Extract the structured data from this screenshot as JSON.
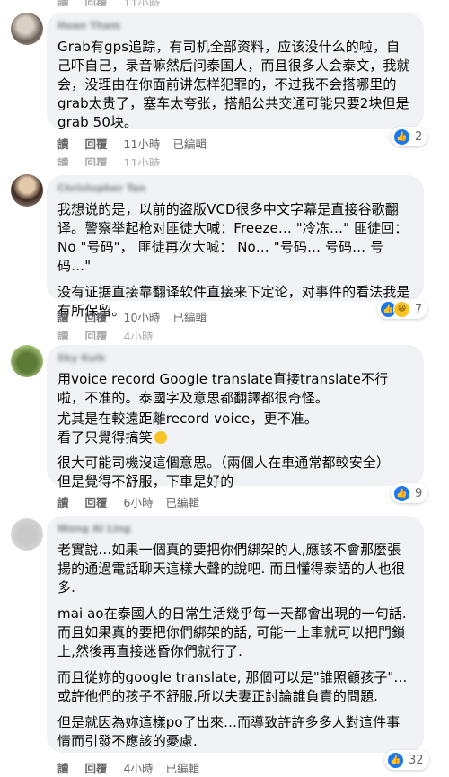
{
  "comments": [
    {
      "author": "Hoan Tham",
      "paragraphs": [
        "Grab有gps追踪，有司机全部资料，应该没什么的啦，自己吓自己，录音嘛然后问泰国人，而且很多人会泰文，我就会，没理由在你面前讲怎样犯罪的，不过我不会搭哪里的grab太贵了，塞车太夸张，搭船公共交通可能只要2块但是grab 50块。"
      ],
      "reaction_count": "2",
      "actions": {
        "read": "讀",
        "reply": "回覆",
        "time": "11小時",
        "edited": "已編輯"
      }
    },
    {
      "author": "Christopher Tan",
      "paragraphs": [
        "我想说的是，以前的盗版VCD很多中文字幕是直接谷歌翻译。警察举起枪对匪徒大喊：Freeze… \"冷冻…\" 匪徒回：No \"号码\"， 匪徒再次大喊： No… \"号码… 号码… 号码…\"",
        "没有证据直接靠翻译软件直接来下定论，对事件的看法我是有所保留。"
      ],
      "reaction_count": "7",
      "actions": {
        "read": "讀",
        "reply": "回覆",
        "time": "10小時",
        "edited": "已編輯"
      }
    },
    {
      "author": "Sky Kuik",
      "paragraphs": [
        "用voice record Google translate直接translate不行啦，不准的。泰國字及意思都翻譯都很奇怪。",
        "尤其是在較遠距離record voice，更不准。",
        "看了只覺得搞笑",
        "很大可能司機沒這個意思。（兩個人在車通常都較安全）",
        "但是覺得不舒服，下車是好的"
      ],
      "reaction_count": "9",
      "actions": {
        "read": "讀",
        "reply": "回覆",
        "time": "6小時",
        "edited": "已編輯"
      }
    },
    {
      "author": "Wong Ai Ling",
      "paragraphs": [
        "老實說…如果一個真的要把你們綁架的人,應該不會那麼張揚的通過電話聊天這樣大聲的說吧. 而且懂得泰語的人也很多.",
        "mai ao在泰國人的日常生活幾乎每一天都會出現的一句話. 而且如果真的要把你們綁架的話, 可能一上車就可以把門鎖上,然後再直接迷昏你們就行了.",
        "而且從妳的google translate, 那個可以是\"誰照顧孩子\"…或許他們的孩子不舒服,所以夫妻正討論誰負責的問題.",
        "但是就因為妳這樣po了出來…而導致許許多多人對這件事情而引發不應該的憂慮."
      ],
      "reaction_count": "32",
      "actions": {
        "read": "讀",
        "reply": "回覆",
        "time": "4小時",
        "edited": "已編輯"
      }
    }
  ],
  "colors": {
    "bubble": "#f0f2f5",
    "text": "#050505",
    "secondary": "#65676b",
    "like_blue": "#1877f2"
  }
}
